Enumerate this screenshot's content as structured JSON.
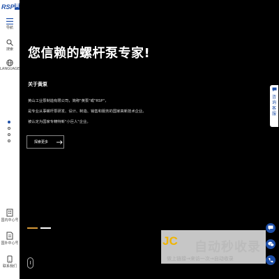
{
  "colors": {
    "accent": "#1e4fa8",
    "background": "#000000",
    "progress_active": "#d89a3a"
  },
  "sidebar": {
    "logo_text": "RSP",
    "logo_badge": "黄泵",
    "items": [
      {
        "icon": "menu-icon",
        "label": "导航"
      },
      {
        "icon": "search-icon",
        "label": "搜索"
      },
      {
        "icon": "globe-icon",
        "label": "LANGUAGE"
      }
    ],
    "bottom_items": [
      {
        "icon": "building-icon",
        "label": "国内中心号"
      },
      {
        "icon": "document-icon",
        "label": "国外中心号"
      },
      {
        "icon": "phone-icon",
        "label": "联系我们"
      }
    ]
  },
  "hero": {
    "title": "您信赖的螺杆泵专家!",
    "subtitle": "关于黄泵",
    "desc": [
      "黄山工业泵制造有限公司，简称\"黄泵\"或\"RSP\"，",
      "是专业从事螺杆泵研发、设计、制造、销售和服务的国家高新技术企业。",
      "被认定为国家专精特新\"小巨人\"企业。"
    ],
    "button_label": "探索更多",
    "slide_count": 4,
    "active_slide": 0
  },
  "right_float": {
    "consult_text": "咨询客服",
    "icons": [
      "chat-icon",
      "wechat-icon",
      "phone-icon"
    ]
  },
  "watermark": {
    "logo": "JC",
    "title": "自动秒收录",
    "slogan": "做上链接→来访一次→自动收录"
  }
}
